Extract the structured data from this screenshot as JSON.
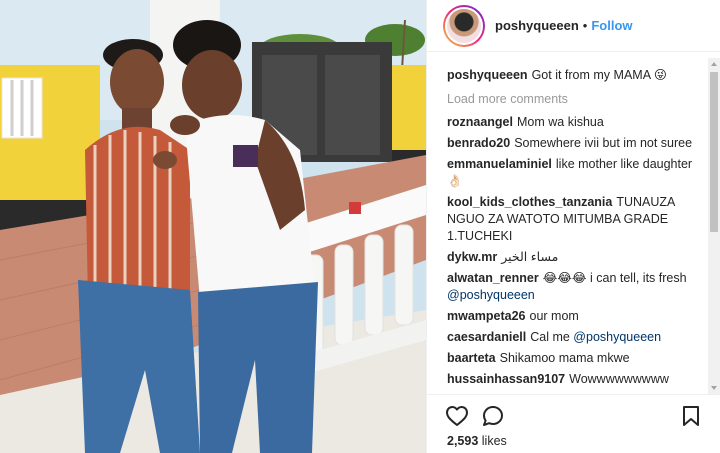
{
  "post": {
    "username": "poshyqueeen",
    "separator": "•",
    "follow_label": "Follow",
    "caption": {
      "user": "poshyqueeen",
      "text": "Got it from my MAMA 😜"
    },
    "load_more_label": "Load more comments",
    "comments": [
      {
        "user": "roznaangel",
        "text": "Mom wa kishua"
      },
      {
        "user": "benrado20",
        "text": "Somewhere ivii but im not suree"
      },
      {
        "user": "emmanuelaminiel",
        "text": "like mother like daughter👌🏻"
      },
      {
        "user": "kool_kids_clothes_tanzania",
        "text": "TUNAUZA NGUO ZA WATOTO MITUMBA GRADE 1.TUCHEKI"
      },
      {
        "user": "dykw.mr",
        "text": "مساء الخير"
      },
      {
        "user": "alwatan_renner",
        "text": "😂😂😂 i can tell, its fresh",
        "mention": "@poshyqueeen"
      },
      {
        "user": "mwampeta26",
        "text": "our mom"
      },
      {
        "user": "caesardaniell",
        "text": "Cal me",
        "mention": "@poshyqueeen"
      },
      {
        "user": "baarteta",
        "text": "Shikamoo mama mkwe"
      },
      {
        "user": "hussainhassan9107",
        "text": "Wowwwwwwwww"
      }
    ],
    "likes_count": "2,593",
    "likes_label": "likes"
  },
  "icons": {
    "heart": "heart-outline-icon",
    "comment": "comment-bubble-icon",
    "save": "bookmark-icon"
  },
  "colors": {
    "follow": "#3897f0",
    "mention": "#003569",
    "muted": "#999999",
    "text": "#262626"
  }
}
